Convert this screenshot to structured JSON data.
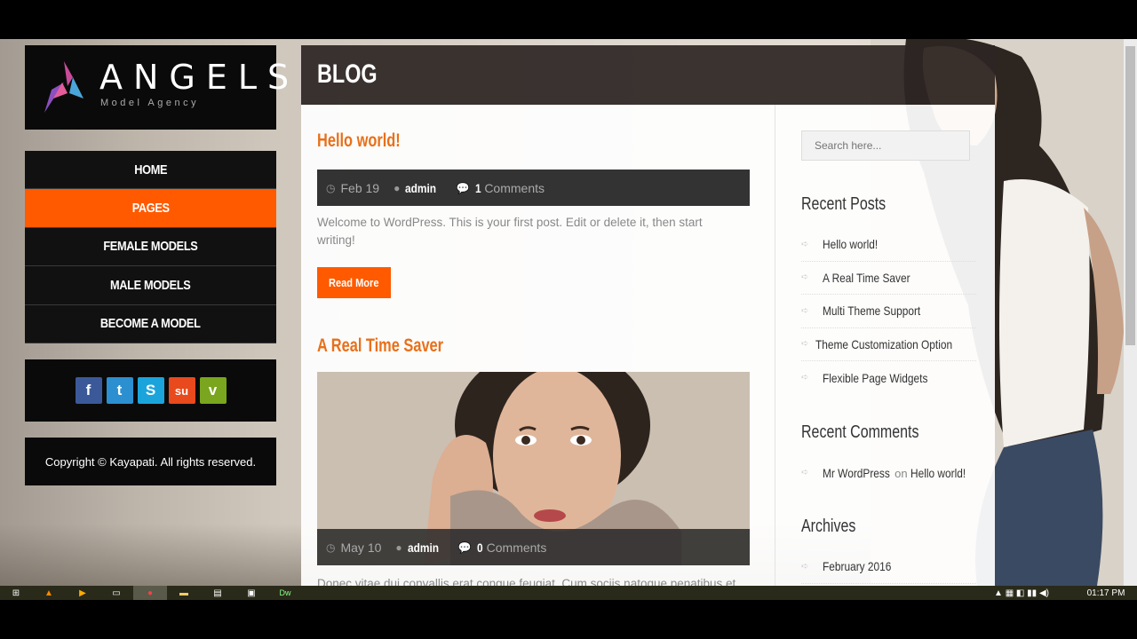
{
  "logo": {
    "name": "ANGELS",
    "tagline": "Model Agency"
  },
  "nav": {
    "items": [
      {
        "label": "HOME",
        "active": false
      },
      {
        "label": "PAGES",
        "active": true
      },
      {
        "label": "FEMALE MODELS",
        "active": false
      },
      {
        "label": "MALE MODELS",
        "active": false
      },
      {
        "label": "BECOME A MODEL",
        "active": false
      }
    ]
  },
  "social": [
    {
      "icon": "facebook-icon",
      "glyph": "f",
      "color": "#3b5998"
    },
    {
      "icon": "twitter-icon",
      "glyph": "t",
      "color": "#2b8fd0"
    },
    {
      "icon": "skype-icon",
      "glyph": "S",
      "color": "#1ba4dc"
    },
    {
      "icon": "stumbleupon-icon",
      "glyph": "su",
      "color": "#e8491d"
    },
    {
      "icon": "vimeo-icon",
      "glyph": "v",
      "color": "#7aa51e"
    }
  ],
  "footer": {
    "copyright": "Copyright © Kayapati. All rights reserved."
  },
  "page": {
    "title": "BLOG"
  },
  "posts": [
    {
      "title": "Hello world!",
      "date": "Feb 19",
      "author": "admin",
      "comment_count": "1",
      "comments_label": "Comments",
      "excerpt": "Welcome to WordPress. This is your first post. Edit or delete it, then start writing!",
      "read_more": "Read More"
    },
    {
      "title": "A Real Time Saver",
      "date": "May 10",
      "author": "admin",
      "comment_count": "0",
      "comments_label": "Comments",
      "excerpt": "Donec vitae dui convallis erat congue feugiat. Cum sociis natoque penatibus et"
    }
  ],
  "sidebar": {
    "search_placeholder": "Search here...",
    "recent_posts_title": "Recent Posts",
    "recent_posts": [
      "Hello world!",
      "A Real Time Saver",
      "Multi Theme Support",
      "Theme Customization Option",
      "Flexible Page Widgets"
    ],
    "recent_comments_title": "Recent Comments",
    "recent_comment": {
      "author": "Mr WordPress",
      "on": "on",
      "post": "Hello world!"
    },
    "archives_title": "Archives",
    "archives": [
      "February 2016"
    ]
  },
  "taskbar": {
    "clock": "01:17 PM",
    "accent": "#ff5a00"
  }
}
